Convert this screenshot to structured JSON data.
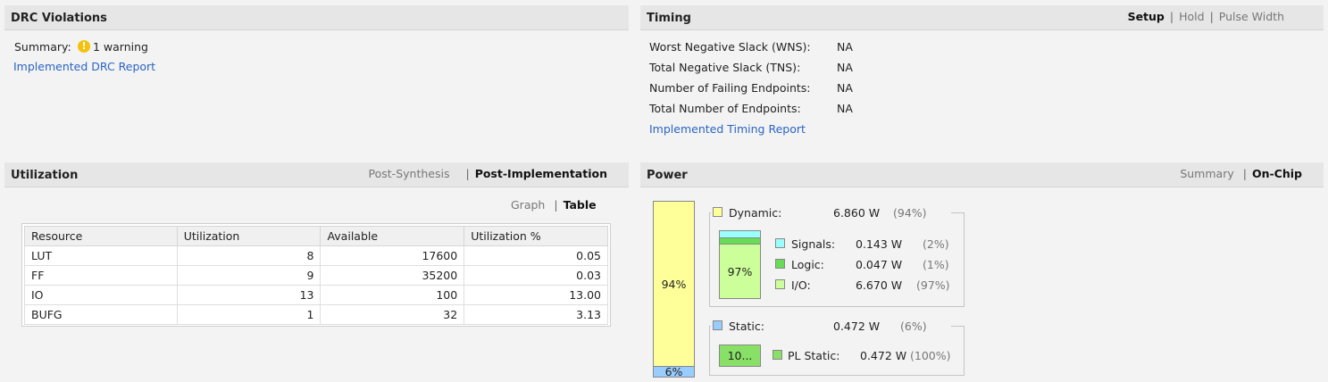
{
  "drc": {
    "title": "DRC Violations",
    "summary_label": "Summary:",
    "warning_text": "1 warning",
    "report_link": "Implemented DRC Report"
  },
  "timing": {
    "title": "Timing",
    "tabs": [
      "Setup",
      "Hold",
      "Pulse Width"
    ],
    "active_tab": "Setup",
    "rows": [
      {
        "label": "Worst Negative Slack (WNS):",
        "value": "NA"
      },
      {
        "label": "Total Negative Slack (TNS):",
        "value": "NA"
      },
      {
        "label": "Number of Failing Endpoints:",
        "value": "NA"
      },
      {
        "label": "Total Number of Endpoints:",
        "value": "NA"
      }
    ],
    "report_link": "Implemented Timing Report"
  },
  "utilization": {
    "title": "Utilization",
    "tabs": [
      "Post-Synthesis",
      "Post-Implementation"
    ],
    "active_tab": "Post-Implementation",
    "view_tabs": [
      "Graph",
      "Table"
    ],
    "active_view": "Table",
    "columns": [
      "Resource",
      "Utilization",
      "Available",
      "Utilization %"
    ],
    "rows": [
      [
        "LUT",
        "8",
        "17600",
        "0.05"
      ],
      [
        "FF",
        "9",
        "35200",
        "0.03"
      ],
      [
        "IO",
        "13",
        "100",
        "13.00"
      ],
      [
        "BUFG",
        "1",
        "32",
        "3.13"
      ]
    ]
  },
  "power": {
    "title": "Power",
    "tabs": [
      "Summary",
      "On-Chip"
    ],
    "active_tab": "On-Chip",
    "bar_dynamic_label": "94%",
    "bar_static_label": "6%",
    "dynamic_fraction": 0.94,
    "static_fraction": 0.06,
    "dynamic": {
      "label": "Dynamic:",
      "value": "6.860 W",
      "pct": "(94%)"
    },
    "dynamic_breakdown_label": "97%",
    "signals": {
      "label": "Signals:",
      "value": "0.143 W",
      "pct": "(2%)"
    },
    "logic": {
      "label": "Logic:",
      "value": "0.047 W",
      "pct": "(1%)"
    },
    "io": {
      "label": "I/O:",
      "value": "6.670 W",
      "pct": "(97%)"
    },
    "static": {
      "label": "Static:",
      "value": "0.472 W",
      "pct": "(6%)"
    },
    "static_breakdown_label": "10...",
    "pl_static": {
      "label": "PL Static:",
      "value": "0.472 W",
      "pct": "(100%)"
    },
    "colors": {
      "dynamic": "#ffff99",
      "static": "#99ccff",
      "signals": "#99ffff",
      "logic": "#66dd55",
      "io": "#ccff99",
      "pl_static": "#88e066"
    }
  }
}
